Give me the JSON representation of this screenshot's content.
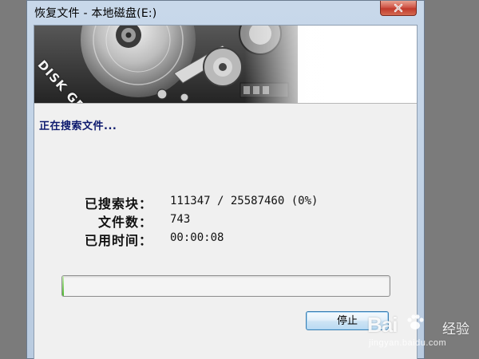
{
  "window": {
    "title": "恢复文件 - 本地磁盘(E:)"
  },
  "banner": {
    "logo_text": "DISK GENIUS"
  },
  "status": {
    "message": "正在搜索文件..."
  },
  "stats": [
    {
      "label": "已搜索块：",
      "value": "111347 / 25587460 (0%)"
    },
    {
      "label": "文件数：",
      "value": "743"
    },
    {
      "label": "已用时间：",
      "value": "00:00:08"
    }
  ],
  "progress": {
    "fraction": 0.004
  },
  "buttons": {
    "stop_label": "停止"
  },
  "watermark": {
    "logo": "Bai",
    "logo_suffix": "百度",
    "cn_text": "经验",
    "url": "jingyan.baidu.com"
  },
  "icons": {
    "close": "close-icon",
    "paw": "baidu-paw-icon"
  }
}
